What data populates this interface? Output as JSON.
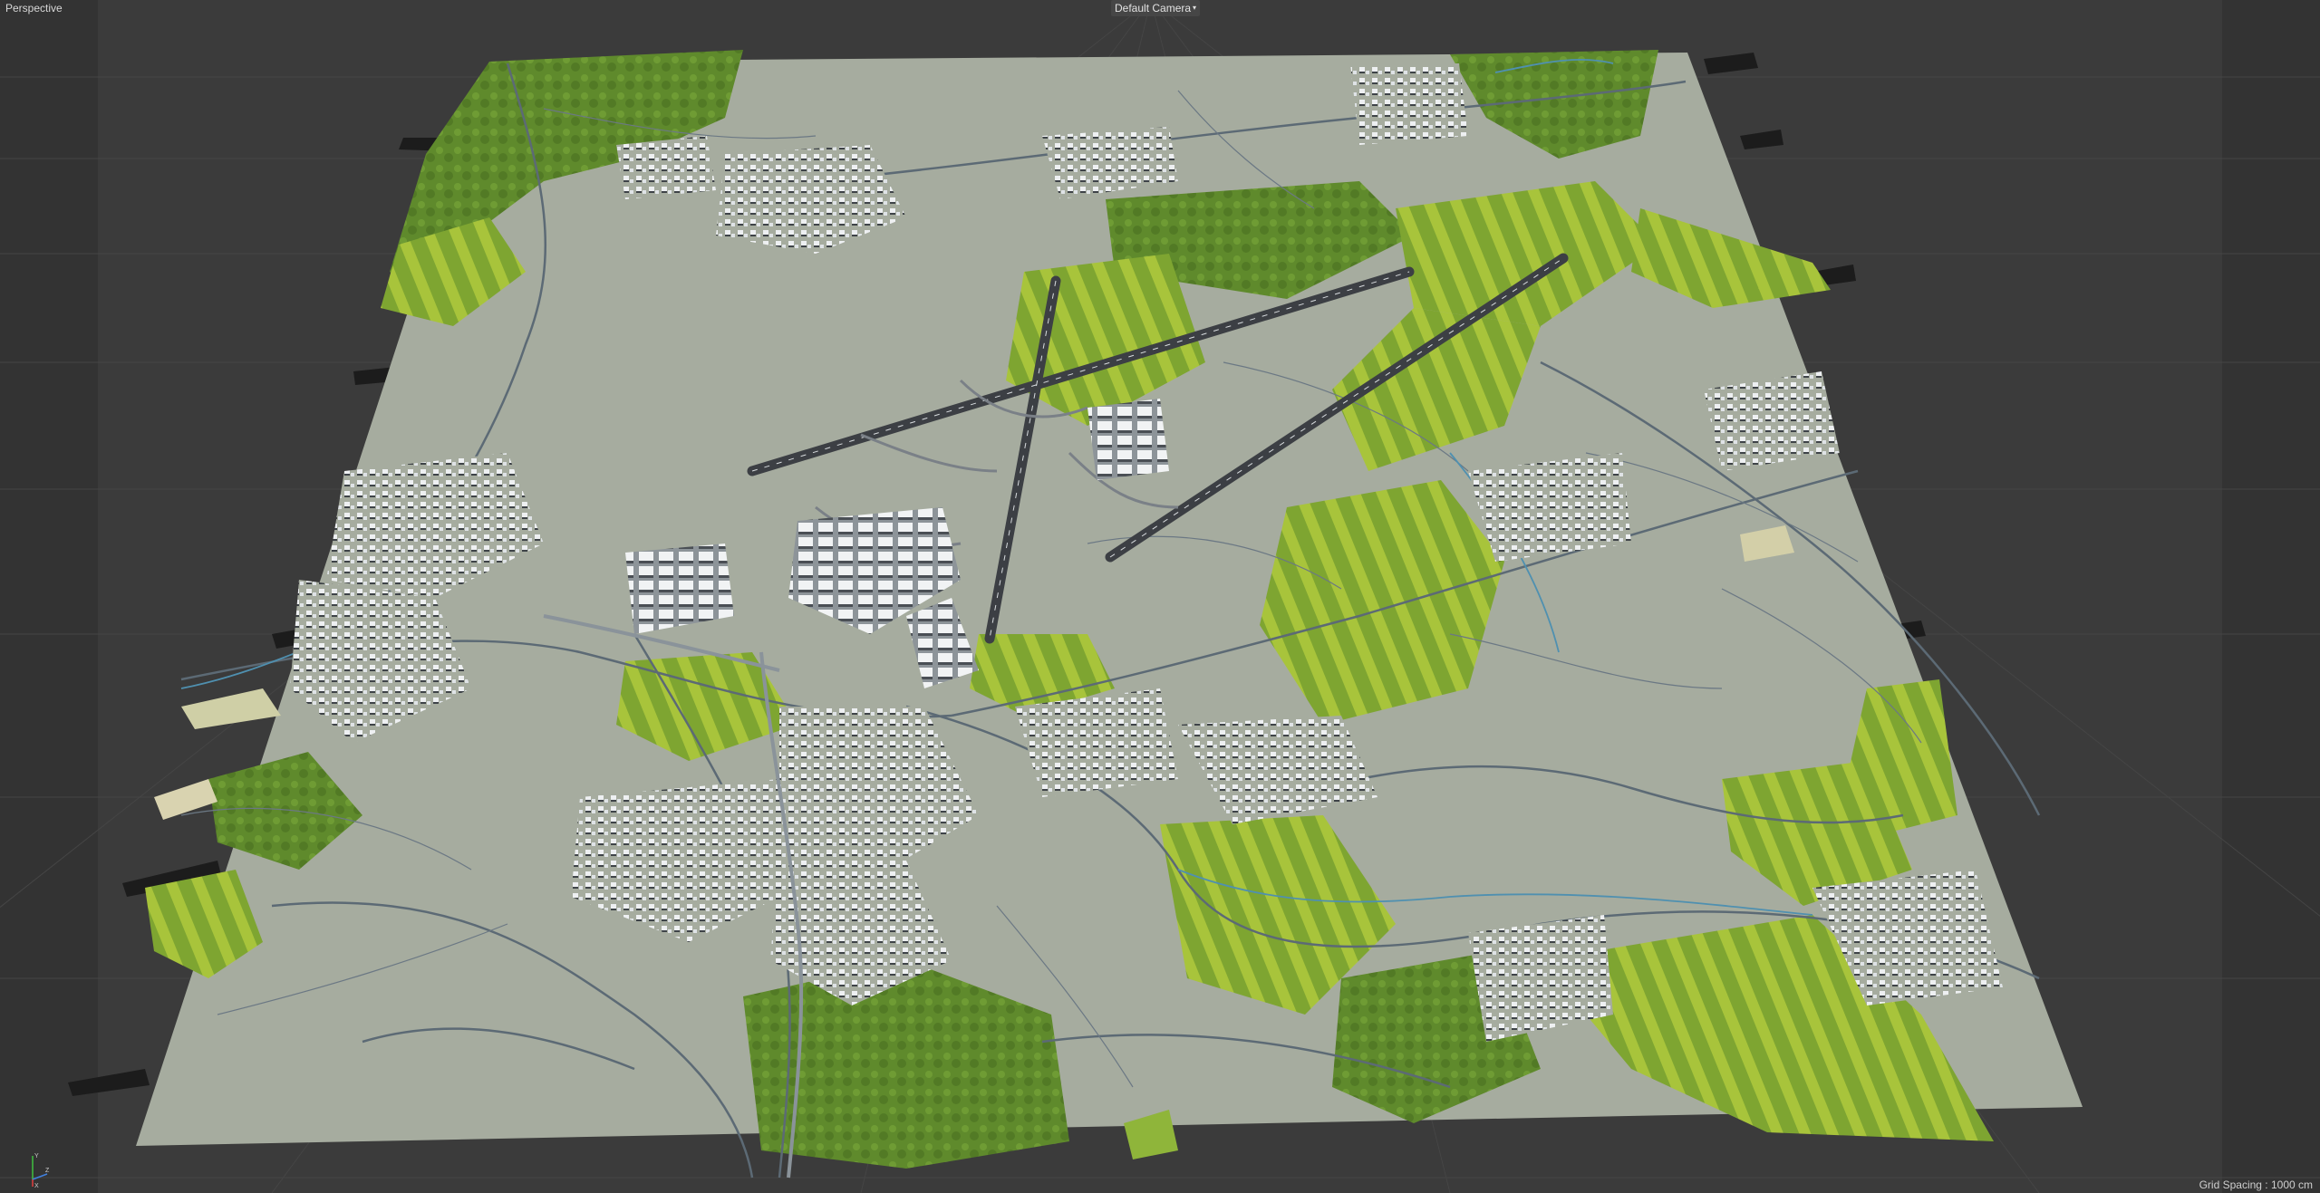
{
  "viewport": {
    "view_name": "Perspective",
    "camera_name": "Default Camera",
    "camera_menu_icon": "camera-dropdown-icon",
    "grid_spacing": "Grid Spacing : 1000 cm"
  },
  "colors": {
    "background": "#3b3b3b",
    "side_band": "#333333",
    "ground_plane": "#a6ac9f",
    "forest": "#6f9a2e",
    "forest_light": "#9fbf3a",
    "road": "#5c6a75",
    "runway": "#3c3f44",
    "water": "#4f90b0",
    "buildings": "#e9ecef",
    "axis_x": "#e04040",
    "axis_y": "#40c040",
    "axis_z": "#4080e0"
  },
  "axis_gizmo": {
    "icon": "axis-gizmo-icon",
    "x_label": "X",
    "y_label": "Y",
    "z_label": "Z"
  }
}
